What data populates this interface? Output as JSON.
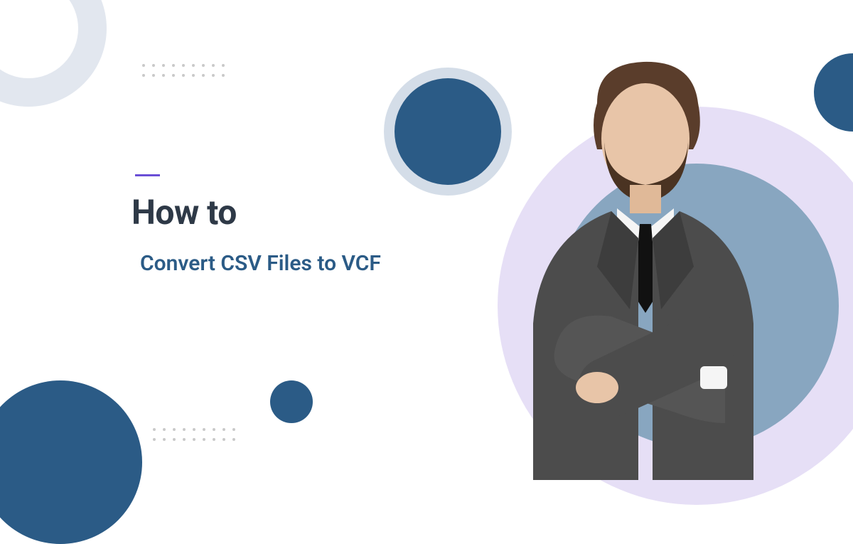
{
  "heading": "How to",
  "subheading": "Convert CSV Files to VCF",
  "colors": {
    "primary_blue": "#2b5b86",
    "steel_blue": "#88a6c0",
    "lavender": "#e6dff6",
    "light_grey": "#e2e7ef",
    "accent_purple": "#6a4fd6",
    "heading_text": "#2e3947"
  }
}
